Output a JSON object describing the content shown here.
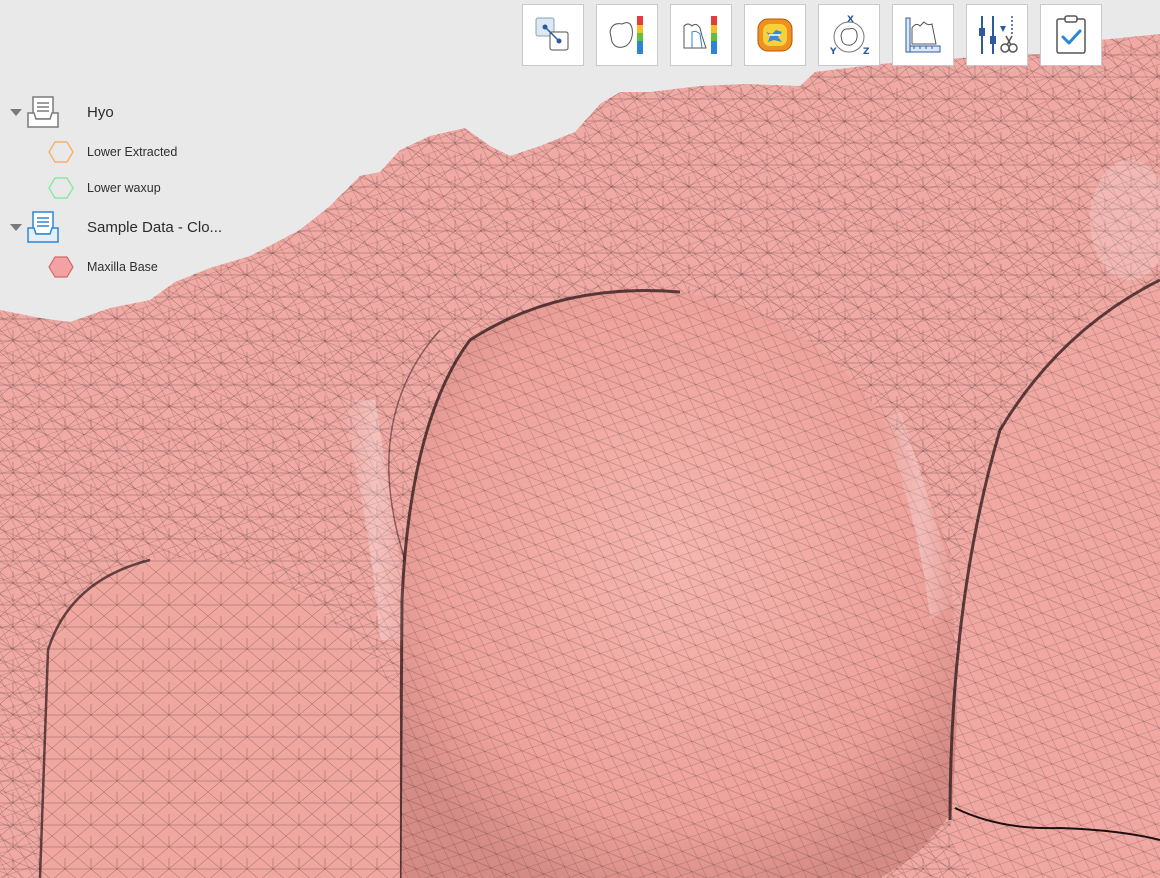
{
  "toolbar": {
    "buttons": [
      {
        "name": "transform-icon"
      },
      {
        "name": "deviation-colormap-icon"
      },
      {
        "name": "section-colormap-icon"
      },
      {
        "name": "occlusion-map-icon"
      },
      {
        "name": "xyz-rotation-icon"
      },
      {
        "name": "measurement-ruler-icon"
      },
      {
        "name": "trim-cut-icon"
      },
      {
        "name": "confirm-checklist-icon"
      }
    ]
  },
  "tree": {
    "groups": [
      {
        "label": "Hyo",
        "icon_color": "#7b7b7b",
        "children": [
          {
            "label": "Lower Extracted",
            "color": "#f2b46e",
            "filled": false
          },
          {
            "label": "Lower waxup",
            "color": "#8ee8a8",
            "filled": false
          }
        ]
      },
      {
        "label": "Sample Data - Clo...",
        "icon_color": "#2c86d4",
        "children": [
          {
            "label": "Maxilla Base",
            "color": "#f2a2a2",
            "filled": true
          }
        ]
      }
    ]
  },
  "viewport": {
    "background": "#e9e9e9",
    "mesh_color": "#f1a9a4",
    "wire_color": "#4a2e2e"
  }
}
